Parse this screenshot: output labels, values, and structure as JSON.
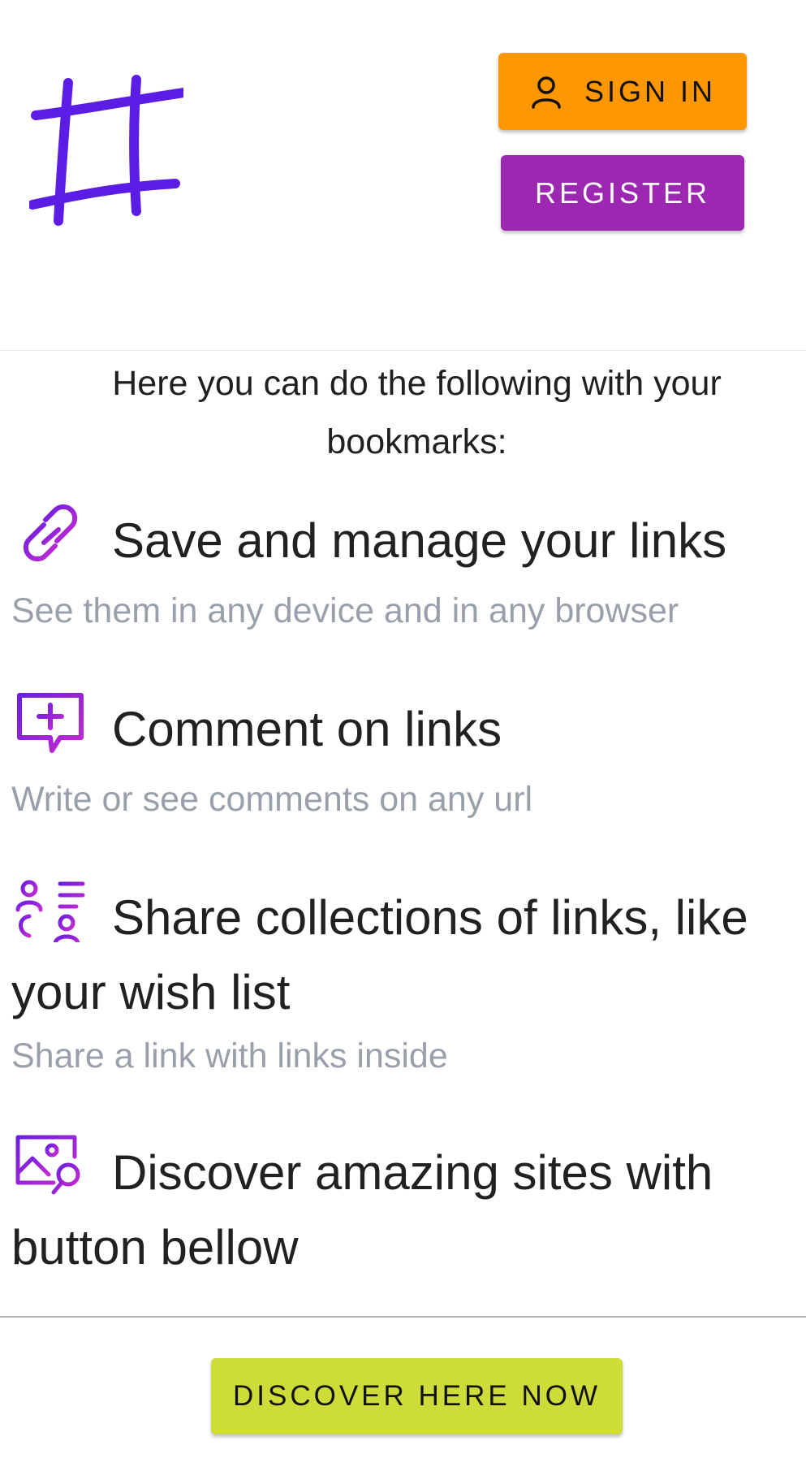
{
  "header": {
    "logo_icon": "hash-logo-icon",
    "sign_in_label": "SIGN IN",
    "sign_in_icon": "user-icon",
    "register_label": "REGISTER"
  },
  "intro": {
    "text": "Here you can do the following with your bookmarks:"
  },
  "features": [
    {
      "icon": "link-icon",
      "title": "Save and manage your links",
      "description": "See them in any device and in any browser"
    },
    {
      "icon": "comment-add-icon",
      "title": "Comment on links",
      "description": "Write or see comments on any url"
    },
    {
      "icon": "share-collection-icon",
      "title": "Share collections of links, like your wish list",
      "description": "Share a link with links inside"
    },
    {
      "icon": "image-search-icon",
      "title": "Discover amazing sites with button bellow",
      "description": ""
    }
  ],
  "footer": {
    "discover_label": "DISCOVER HERE NOW"
  },
  "colors": {
    "sign_in_bg": "#ff9800",
    "register_bg": "#9c27b0",
    "discover_bg": "#cddc39",
    "icon_gradient_start": "#6a1fe0",
    "icon_gradient_end": "#c62bd0",
    "description_text": "#9aa0ab"
  }
}
